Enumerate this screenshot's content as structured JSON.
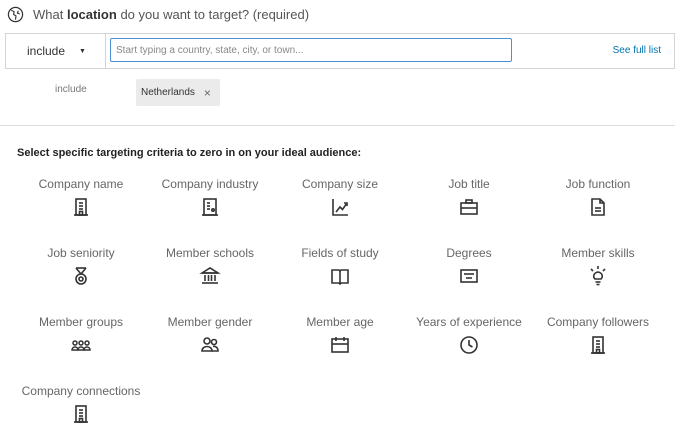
{
  "location": {
    "question_prefix": "What",
    "question_bold": "location",
    "question_suffix": "do you want to target? (required)",
    "icon": "globe-icon",
    "include_select": "include",
    "search_placeholder": "Start typing a country, state, city, or town...",
    "see_full_list": "See full list"
  },
  "selected": {
    "label": "include",
    "chips": [
      {
        "label": "Netherlands",
        "remove_icon": "×"
      }
    ]
  },
  "criteria": {
    "heading": "Select specific targeting criteria to zero in on your ideal audience:",
    "items": [
      {
        "label": "Company name",
        "icon": "building-icon"
      },
      {
        "label": "Company industry",
        "icon": "industry-icon"
      },
      {
        "label": "Company size",
        "icon": "chart-up-icon"
      },
      {
        "label": "Job title",
        "icon": "briefcase-icon"
      },
      {
        "label": "Job function",
        "icon": "document-icon"
      },
      {
        "label": "Job seniority",
        "icon": "medal-icon"
      },
      {
        "label": "Member schools",
        "icon": "school-icon"
      },
      {
        "label": "Fields of study",
        "icon": "book-icon"
      },
      {
        "label": "Degrees",
        "icon": "diploma-icon"
      },
      {
        "label": "Member skills",
        "icon": "lightbulb-icon"
      },
      {
        "label": "Member groups",
        "icon": "group-icon"
      },
      {
        "label": "Member gender",
        "icon": "people-icon"
      },
      {
        "label": "Member age",
        "icon": "calendar-icon"
      },
      {
        "label": "Years of experience",
        "icon": "clock-icon"
      },
      {
        "label": "Company followers",
        "icon": "building-icon"
      },
      {
        "label": "Company connections",
        "icon": "building-icon"
      }
    ]
  }
}
